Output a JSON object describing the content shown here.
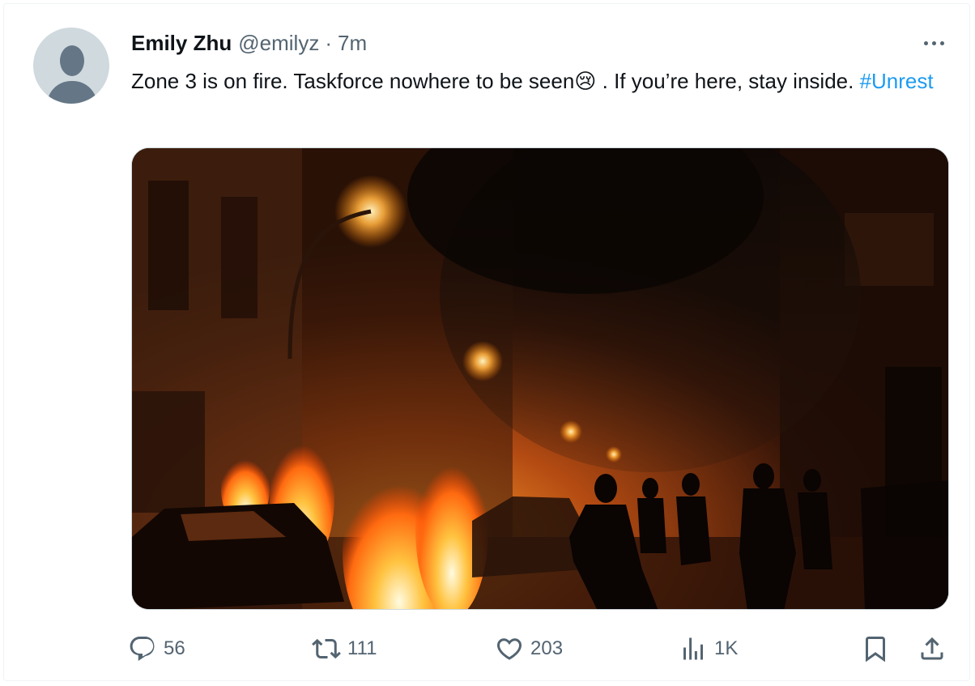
{
  "tweet": {
    "display_name": "Emily Zhu",
    "handle": "@emilyz",
    "separator": "·",
    "time": "7m",
    "text_before": "Zone 3 is on fire. Taskforce nowhere to be seen",
    "emoji": "😢",
    "text_after": " . If you’re here, stay inside. ",
    "hashtag": "#Unrest"
  },
  "media": {
    "description_icon": "photo"
  },
  "actions": {
    "replies": "56",
    "retweets": "111",
    "likes": "203",
    "views": "1K"
  },
  "icons": {
    "reply": "reply-icon",
    "retweet": "retweet-icon",
    "like": "heart-icon",
    "views": "views-icon",
    "bookmark": "bookmark-icon",
    "share": "share-icon",
    "more": "more-icon"
  },
  "colors": {
    "text": "#0f1419",
    "secondary": "#536471",
    "link": "#1d9bf0",
    "border": "#cfd9de"
  }
}
